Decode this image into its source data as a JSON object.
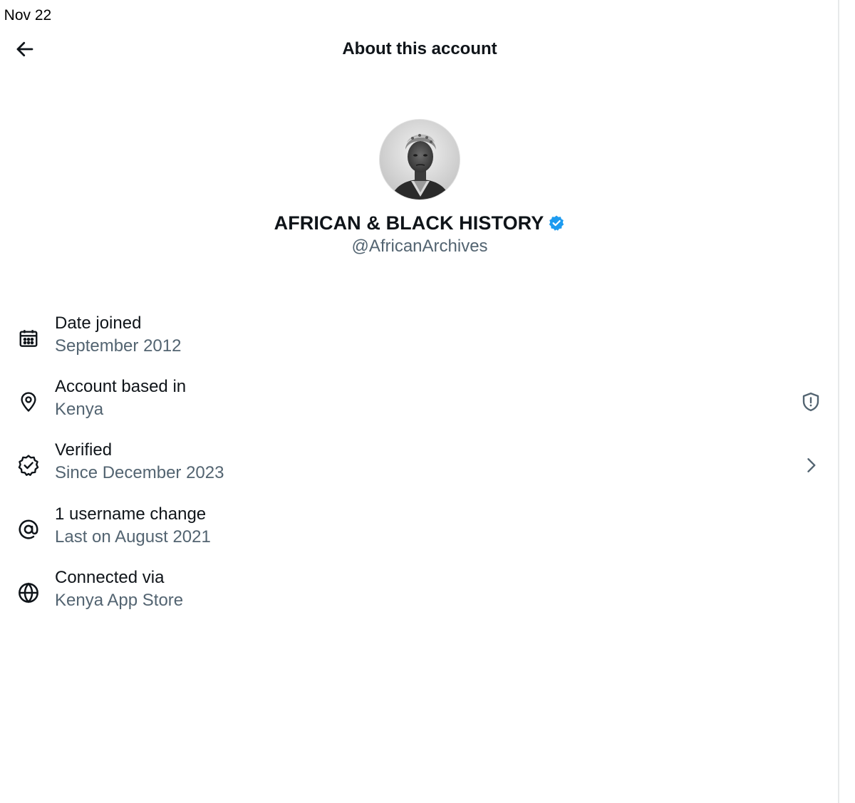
{
  "status_bar": {
    "time": ": Nov 22"
  },
  "header": {
    "back_icon": "arrow-left-icon",
    "title": "About this account"
  },
  "profile": {
    "avatar_icon": "profile-avatar-photo",
    "display_name": "AFRICAN & BLACK HISTORY",
    "verified_icon": "verified-badge-icon",
    "handle": "@AfricanArchives"
  },
  "info_items": [
    {
      "icon": "calendar-icon",
      "title": "Date joined",
      "value": "September 2012",
      "trailing_icon": ""
    },
    {
      "icon": "location-pin-icon",
      "title": "Account based in",
      "value": "Kenya",
      "trailing_icon": "shield-alert-icon"
    },
    {
      "icon": "verified-check-icon",
      "title": "Verified",
      "value": "Since December 2023",
      "trailing_icon": "chevron-right-icon"
    },
    {
      "icon": "at-sign-icon",
      "title": "1 username change",
      "value": "Last on August 2021",
      "trailing_icon": ""
    },
    {
      "icon": "globe-icon",
      "title": "Connected via",
      "value": "Kenya App Store",
      "trailing_icon": ""
    }
  ],
  "colors": {
    "text_primary": "#0f1419",
    "text_secondary": "#536471",
    "verified_blue": "#1d9bf0",
    "background": "#ffffff"
  }
}
